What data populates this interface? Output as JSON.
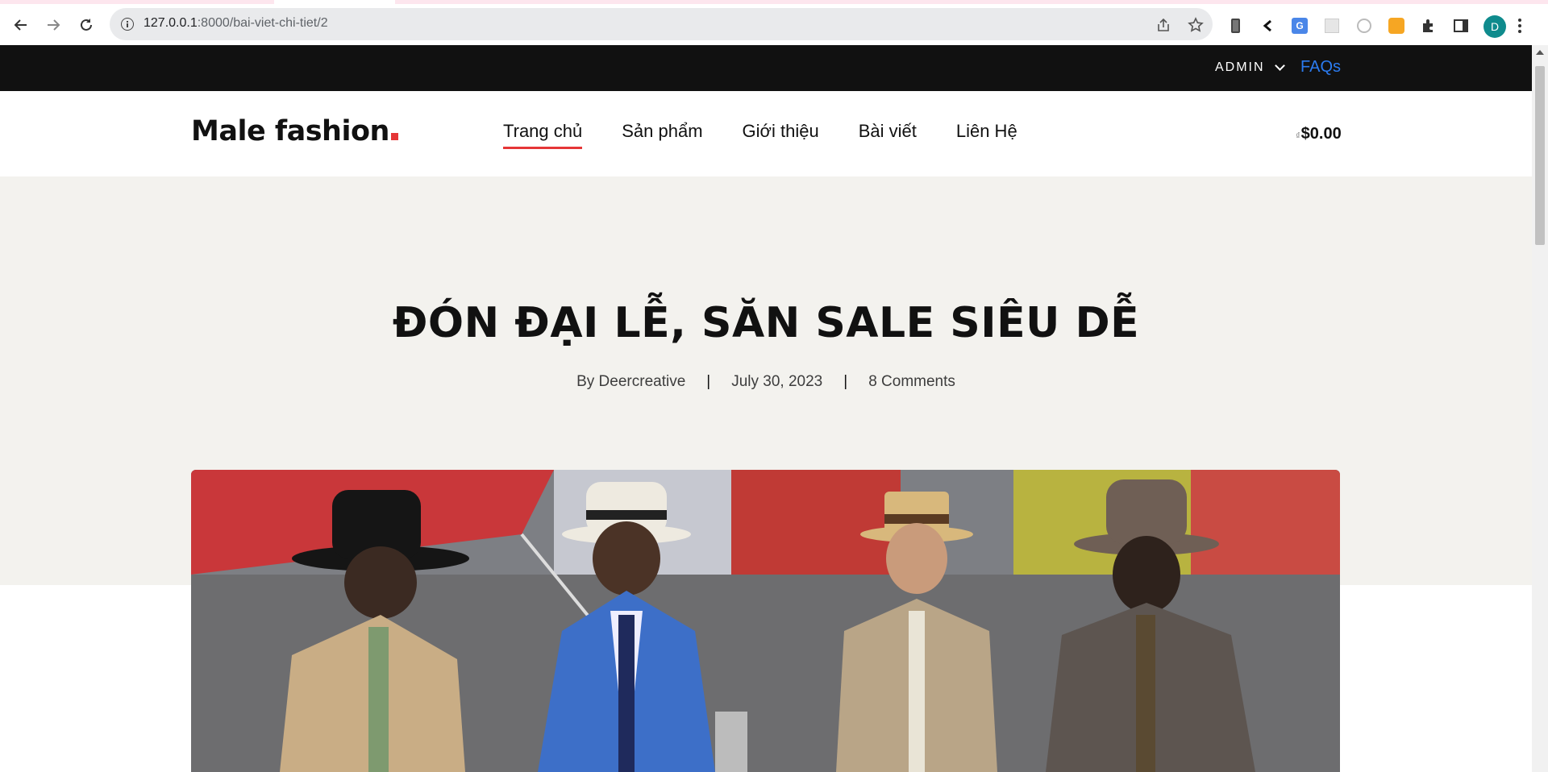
{
  "browser": {
    "url_host": "127.0.0.1",
    "url_path": ":8000/bai-viet-chi-tiet/2",
    "profile_initial": "D"
  },
  "topbar": {
    "account_label": "ADMIN",
    "faqs_label": "FAQs"
  },
  "header": {
    "logo_text": "Male fashion",
    "nav": [
      {
        "label": "Trang chủ",
        "active": true
      },
      {
        "label": "Sản phẩm",
        "active": false
      },
      {
        "label": "Giới thiệu",
        "active": false
      },
      {
        "label": "Bài viết",
        "active": false
      },
      {
        "label": "Liên Hệ",
        "active": false
      }
    ],
    "cart_prefix": "₫",
    "cart_total": "$0.00"
  },
  "post": {
    "title": "ĐÓN ĐẠI LỄ, SĂN SALE SIÊU DỄ",
    "author": "By Deercreative",
    "date": "July 30, 2023",
    "comments": "8 Comments",
    "separator": "|"
  },
  "colors": {
    "accent": "#e53637",
    "topbar_bg": "#111111",
    "hero_bg": "#f3f2ee",
    "link_blue": "#2b7bf0"
  }
}
